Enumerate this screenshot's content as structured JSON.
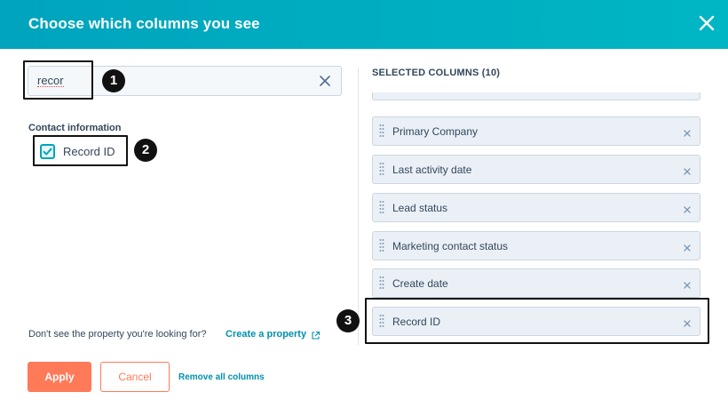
{
  "header": {
    "title": "Choose which columns you see"
  },
  "search": {
    "value": "recor"
  },
  "contact_info": {
    "section_label": "Contact information",
    "checkbox_label": "Record ID",
    "checked": true
  },
  "footer": {
    "note": "Don't see the property you're looking for?",
    "create_link": "Create a property"
  },
  "selected": {
    "heading": "SELECTED COLUMNS (10)",
    "items": [
      {
        "label": "Primary Company"
      },
      {
        "label": "Last activity date"
      },
      {
        "label": "Lead status"
      },
      {
        "label": "Marketing contact status"
      },
      {
        "label": "Create date"
      },
      {
        "label": "Record ID"
      }
    ]
  },
  "buttons": {
    "apply": "Apply",
    "cancel": "Cancel",
    "remove_all": "Remove all columns"
  },
  "annotations": {
    "one": "1",
    "two": "2",
    "three": "3"
  },
  "colors": {
    "header": "#00a4bd",
    "primary": "#ff7a59",
    "link": "#0091ae",
    "chip": "#eaf0f6"
  }
}
